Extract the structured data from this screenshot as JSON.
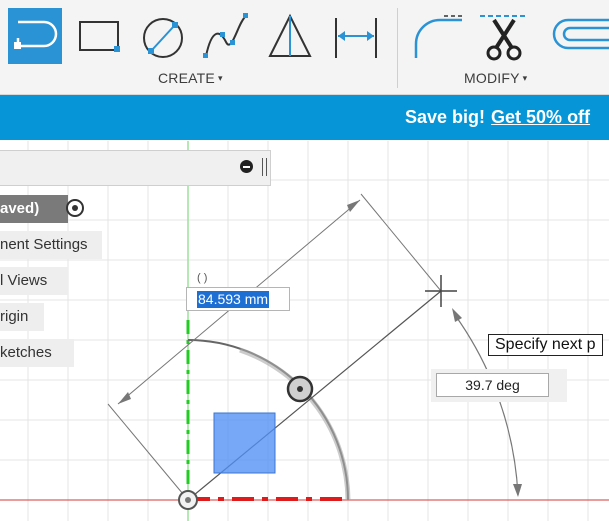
{
  "toolbar": {
    "groups": [
      {
        "label": "CREATE",
        "caret": "▾"
      },
      {
        "label": "MODIFY",
        "caret": "▾"
      }
    ],
    "create_tools": [
      "center-point-arc-slot-icon",
      "rectangle-icon",
      "circle-icon",
      "spline-icon",
      "triangle-icon",
      "dimension-icon"
    ],
    "modify_tools": [
      "fillet-icon",
      "trim-icon",
      "offset-icon"
    ],
    "active_tool": "center-point-arc-slot-icon",
    "accent": "#2a93d5"
  },
  "banner": {
    "text": "Save big!",
    "link": "Get 50% off",
    "color": "#0696d7"
  },
  "browser": {
    "nodes": [
      "aved)",
      "nent Settings",
      "l Views",
      "rigin",
      "ketches"
    ]
  },
  "sketch": {
    "length_value": "84.593 mm",
    "angle_value": "39.7 deg",
    "prompt": "Specify next p",
    "axis_label": "(  )"
  },
  "colors": {
    "grid": "#e4e4e4",
    "y_axis": "#2ec42e",
    "x_axis": "#d62020",
    "selection": "#3f8ff0"
  }
}
